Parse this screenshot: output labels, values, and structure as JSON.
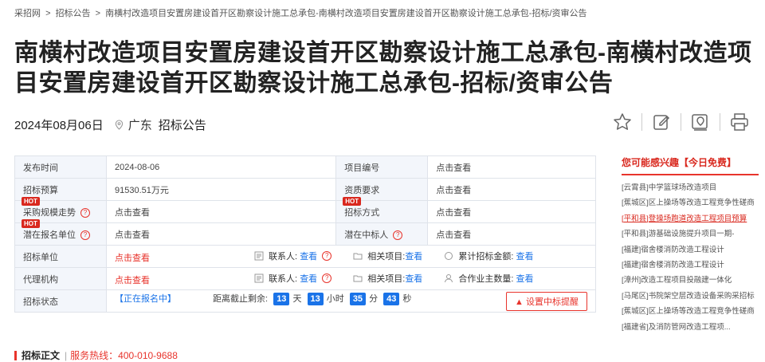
{
  "breadcrumb": [
    "采招网",
    ">",
    "招标公告",
    ">",
    "南横村改造项目安置房建设首开区勘察设计施工总承包-南横村改造项目安置房建设首开区勘察设计施工总承包-招标/资审公告"
  ],
  "title": "南横村改造项目安置房建设首开区勘察设计施工总承包-南横村改造项目安置房建设首开区勘察设计施工总承包-招标/资审公告",
  "meta": {
    "date": "2024年08月06日",
    "region": "广东",
    "category": "招标公告"
  },
  "table": {
    "publish_time_label": "发布时间",
    "publish_time": "2024-08-06",
    "project_no_label": "项目编号",
    "view": "点击查看",
    "budget_label": "招标预算",
    "budget": "91530.51万元",
    "qualification_label": "资质要求",
    "trend_label": "采购规模走势",
    "method_label": "招标方式",
    "potential_label": "潜在报名单位",
    "potential_winner_label": "潜在中标人",
    "hot": "HOT",
    "tenderer_label": "招标单位",
    "agent_label": "代理机构",
    "contact_label": "联系人:",
    "check": "查看",
    "related_label": "相关项目:",
    "total_amount_label": "累计招标金额:",
    "partners_label": "合作业主数量:",
    "status_label": "招标状态",
    "status": "【正在报名中】",
    "countdown_label": "距离截止剩余:",
    "days": "13",
    "day_unit": "天",
    "hours": "13",
    "hour_unit": "小时",
    "minutes": "35",
    "minute_unit": "分",
    "seconds": "43",
    "second_unit": "秒",
    "remind": "设置中标提醒"
  },
  "sidebar": {
    "heading": "您可能感兴趣【今日免费】",
    "items": [
      "[云霄县]中学篮球场改造项目",
      "[蕉城区]区上操场等改造工程竞争性磋商",
      "[平和县]登操场跑道改造工程项目预算",
      "[平和县]游基础设施提升项目一期-",
      "[福建]宿舍楼消防改造工程设计",
      "[福建]宿舍楼消防改造工程设计",
      "[漳州]改造工程项目投融建一体化",
      "[马尾区]书院架空层改造设备采购采招标",
      "[蕉城区]区上操场等改造工程竞争性磋商",
      "[福建省]及消防管网改造工程项..."
    ]
  },
  "bottom": {
    "title": "招标正文",
    "phone": "服务热线：400-010-9688"
  },
  "colors": {
    "accent": "#e8342c",
    "link": "#1a73e8"
  },
  "icons": [
    "star-icon",
    "edit-icon",
    "location-icon",
    "print-icon",
    "pin-icon",
    "question-icon",
    "bell-icon"
  ]
}
